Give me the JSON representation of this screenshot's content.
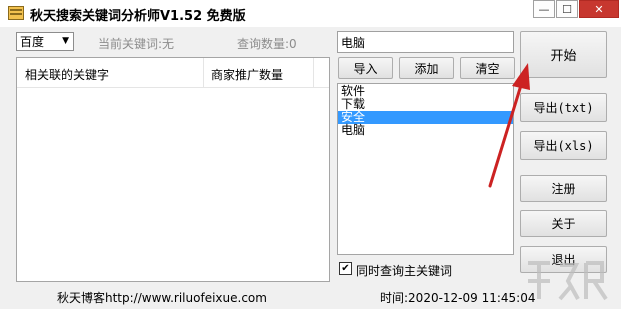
{
  "window": {
    "title": "秋天搜索关键词分析师V1.52 免费版",
    "min_glyph": "—",
    "max_glyph": "☐",
    "close_glyph": "✕"
  },
  "toolbar": {
    "engine_selected": "百度",
    "current_keyword_label": "当前关键词:无",
    "query_count_label": "查询数量:0"
  },
  "table": {
    "columns": [
      "相关联的关键字",
      "商家推广数量"
    ],
    "rows": []
  },
  "keyword_panel": {
    "input_value": "电脑",
    "import_label": "导入",
    "add_label": "添加",
    "clear_label": "清空",
    "items": [
      "软件",
      "下载",
      "安全",
      "电脑"
    ],
    "selected_index": 2,
    "checkbox_label": "同时查询主关键词",
    "checkbox_checked": true
  },
  "actions": {
    "start": "开始",
    "export_txt": "导出(txt)",
    "export_xls": "导出(xls)",
    "register": "注册",
    "about": "关于",
    "exit": "退出"
  },
  "footer": {
    "blog": "秋天博客http://www.riluofeixue.com",
    "time": "时间:2020-12-09 11:45:04"
  },
  "colors": {
    "selection": "#3399ff",
    "annotation_arrow": "#cc2222",
    "close_button": "#c7372f"
  }
}
